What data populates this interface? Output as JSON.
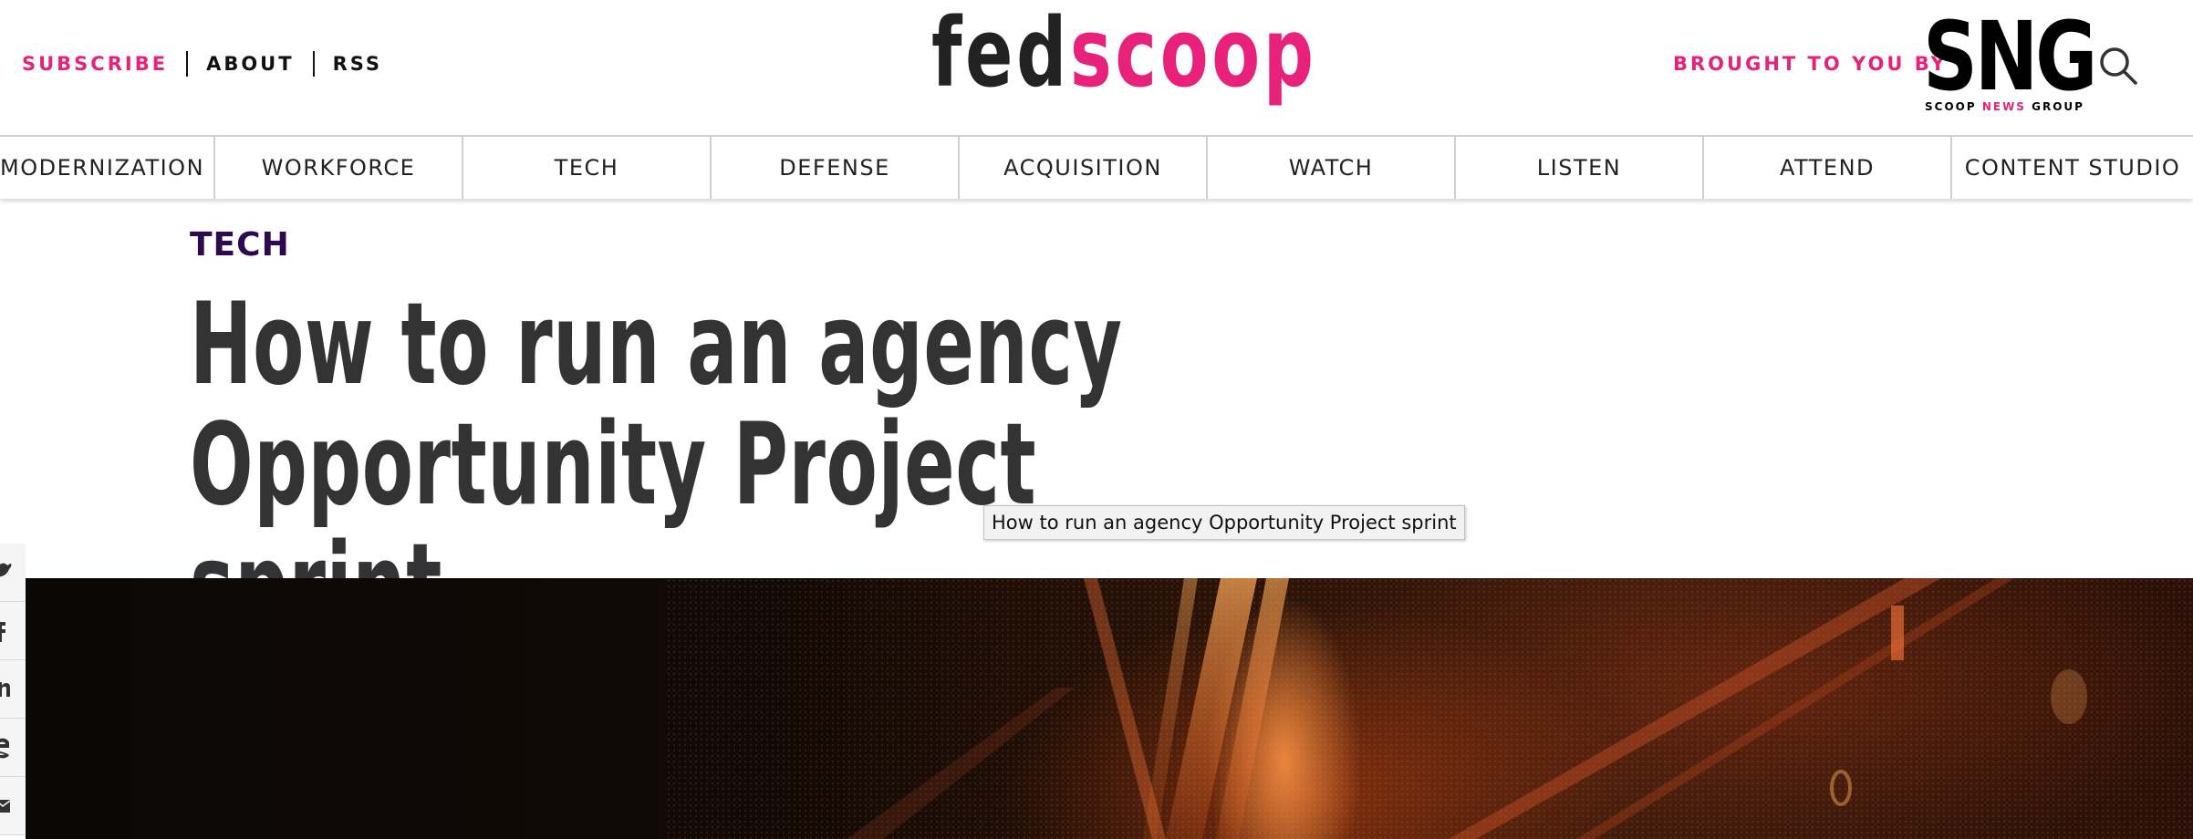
{
  "header": {
    "util_links": [
      {
        "label": "SUBSCRIBE"
      },
      {
        "label": "ABOUT"
      },
      {
        "label": "RSS"
      }
    ],
    "logo": {
      "part1": "fed",
      "part2": "scoop"
    },
    "brought_by": "BROUGHT TO YOU BY",
    "sponsor_logo": {
      "letters": "SNG",
      "sub_left": "SCOOP ",
      "sub_accent": "NEWS",
      "sub_right": " GROUP"
    }
  },
  "nav": {
    "items": [
      "MODERNIZATION",
      "WORKFORCE",
      "TECH",
      "DEFENSE",
      "ACQUISITION",
      "WATCH",
      "LISTEN",
      "ATTEND",
      "CONTENT STUDIO"
    ]
  },
  "article": {
    "category": "TECH",
    "title": "How to run an agency Opportunity Project sprint",
    "tooltip": "How to run an agency Opportunity Project sprint"
  },
  "share": {
    "icons": [
      "twitter-icon",
      "facebook-icon",
      "linkedin-icon",
      "google-plus-icon",
      "email-icon"
    ]
  },
  "colors": {
    "accent_pink": "#e8227a",
    "category_purple": "#2d0a4e",
    "title_gray": "#333333"
  }
}
